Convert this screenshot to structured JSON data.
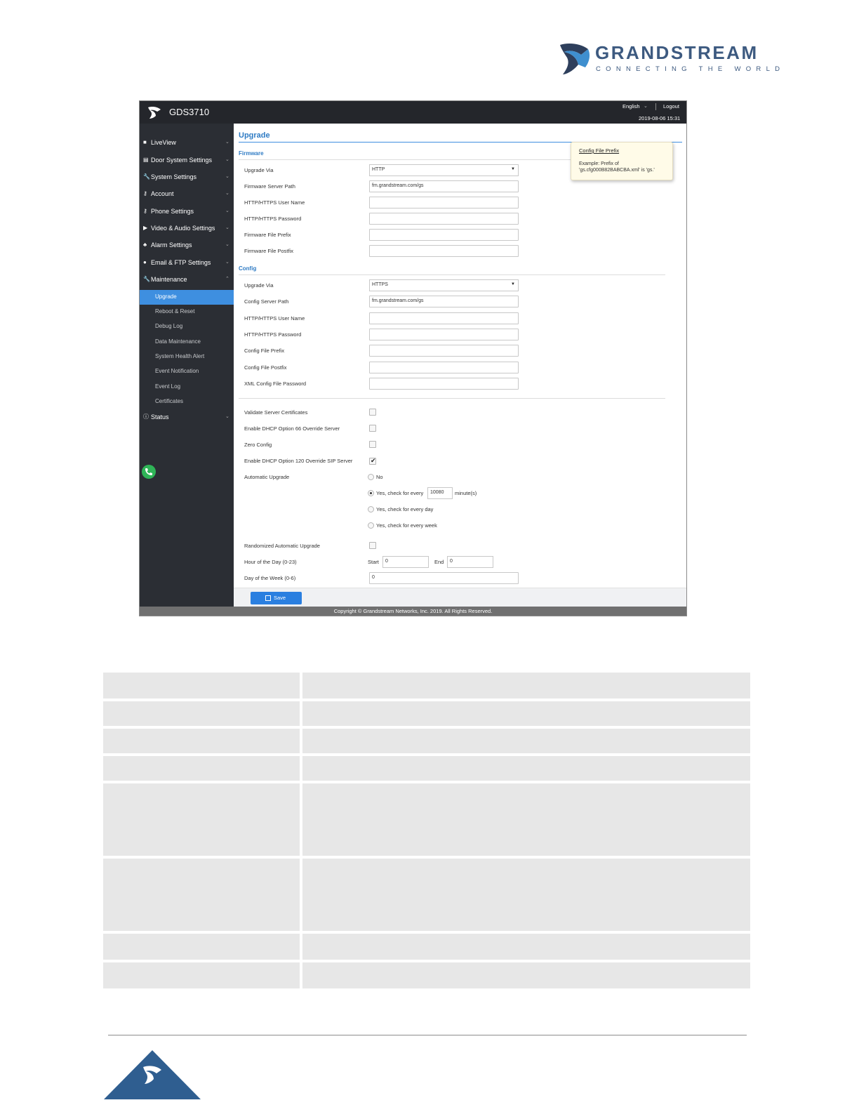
{
  "brand": {
    "name": "GRANDSTREAM",
    "tagline": "CONNECTING THE WORLD",
    "color": "#3d5a80"
  },
  "app": {
    "title": "GDS3710",
    "language": "English",
    "logout": "Logout",
    "datetime": "2019-08-06 15:31",
    "accent": "#3e8fe0"
  },
  "sidebar": {
    "items": [
      {
        "label": "LiveView",
        "icon": "play-icon"
      },
      {
        "label": "Door System Settings",
        "icon": "door-icon"
      },
      {
        "label": "System Settings",
        "icon": "wrench-icon"
      },
      {
        "label": "Account",
        "icon": "key-icon"
      },
      {
        "label": "Phone Settings",
        "icon": "key-icon"
      },
      {
        "label": "Video & Audio Settings",
        "icon": "video-icon"
      },
      {
        "label": "Alarm Settings",
        "icon": "bell-icon"
      },
      {
        "label": "Email & FTP Settings",
        "icon": "cloud-icon"
      },
      {
        "label": "Maintenance",
        "icon": "wrench-icon"
      }
    ],
    "sub_items": [
      "Upgrade",
      "Reboot & Reset",
      "Debug Log",
      "Data Maintenance",
      "System Health Alert",
      "Event Notification",
      "Event Log",
      "Certificates"
    ],
    "status": {
      "label": "Status",
      "icon": "info-icon"
    }
  },
  "page": {
    "title": "Upgrade",
    "firmware": {
      "heading": "Firmware",
      "upgrade_via_label": "Upgrade Via",
      "upgrade_via_value": "HTTP",
      "server_path_label": "Firmware Server Path",
      "server_path_value": "fm.grandstream.com/gs",
      "user_label": "HTTP/HTTPS User Name",
      "password_label": "HTTP/HTTPS Password",
      "prefix_label": "Firmware File Prefix",
      "postfix_label": "Firmware File Postfix"
    },
    "config": {
      "heading": "Config",
      "upgrade_via_label": "Upgrade Via",
      "upgrade_via_value": "HTTPS",
      "server_path_label": "Config Server Path",
      "server_path_value": "fm.grandstream.com/gs",
      "user_label": "HTTP/HTTPS User Name",
      "password_label": "HTTP/HTTPS Password",
      "prefix_label": "Config File Prefix",
      "postfix_label": "Config File Postfix",
      "xml_password_label": "XML Config File Password"
    },
    "options": {
      "validate_label": "Validate Server Certificates",
      "dhcp66_label": "Enable DHCP Option 66 Override Server",
      "zero_config_label": "Zero Config",
      "dhcp120_label": "Enable DHCP Option 120 Override SIP Server",
      "auto_upgrade_label": "Automatic Upgrade",
      "radio_no": "No",
      "radio_every_prefix": "Yes, check for every",
      "radio_every_value": "10080",
      "radio_every_suffix": "minute(s)",
      "radio_day": "Yes, check for every day",
      "radio_week": "Yes, check for every week",
      "randomized_label": "Randomized Automatic Upgrade",
      "hour_label": "Hour of the Day (0-23)",
      "start_label": "Start",
      "start_value": "0",
      "end_label": "End",
      "end_value": "0",
      "dow_label": "Day of the Week (0-6)",
      "dow_value": "0"
    },
    "tooltip": {
      "title": "Config File Prefix",
      "body": "Example: Prefix of 'gs.cfg000B82BABCBA.xml' is 'gs.'"
    },
    "save_label": "Save",
    "copyright": "Copyright © Grandstream Networks, Inc. 2019. All Rights Reserved."
  }
}
